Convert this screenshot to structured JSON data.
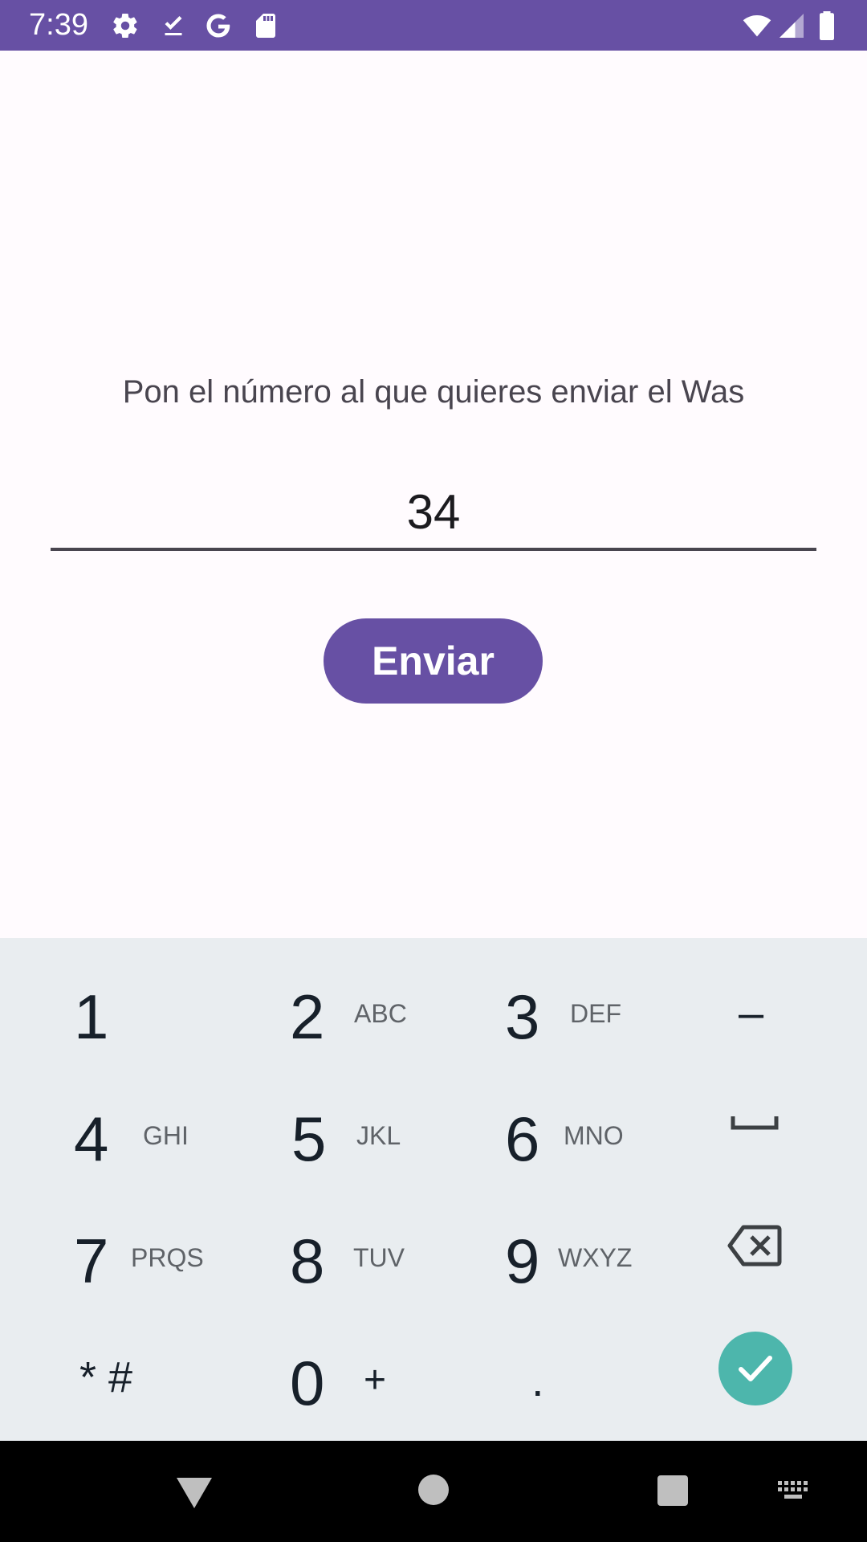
{
  "status_bar": {
    "time": "7:39",
    "background_color": "#6750a4",
    "left_icons": [
      "settings-icon",
      "download-done-icon",
      "google-icon",
      "sd-card-icon"
    ],
    "right_icons": [
      "wifi-icon",
      "cell-signal-icon",
      "battery-icon"
    ]
  },
  "main": {
    "prompt": "Pon el número al que quieres enviar el Was",
    "number_field": {
      "value": "34"
    },
    "send_button_label": "Enviar",
    "accent_color": "#6750a4"
  },
  "keyboard": {
    "background_color": "#e9edf0",
    "rows": [
      [
        {
          "digit": "1",
          "letters": ""
        },
        {
          "digit": "2",
          "letters": "ABC"
        },
        {
          "digit": "3",
          "letters": "DEF"
        },
        {
          "symbol": "–",
          "name": "minus"
        }
      ],
      [
        {
          "digit": "4",
          "letters": "GHI"
        },
        {
          "digit": "5",
          "letters": "JKL"
        },
        {
          "digit": "6",
          "letters": "MNO"
        },
        {
          "symbol": "space-icon",
          "name": "space"
        }
      ],
      [
        {
          "digit": "7",
          "letters": "PRQS"
        },
        {
          "digit": "8",
          "letters": "TUV"
        },
        {
          "digit": "9",
          "letters": "WXYZ"
        },
        {
          "symbol": "backspace-icon",
          "name": "backspace"
        }
      ],
      [
        {
          "symbol": "* #",
          "name": "symbols"
        },
        {
          "digit": "0",
          "letters": "+"
        },
        {
          "symbol": ".",
          "name": "period"
        },
        {
          "symbol": "check-icon",
          "name": "enter"
        }
      ]
    ],
    "enter_color": "#4db6ac"
  },
  "nav_bar": {
    "items": [
      "back-icon",
      "home-icon",
      "recents-icon",
      "keyboard-icon"
    ]
  }
}
